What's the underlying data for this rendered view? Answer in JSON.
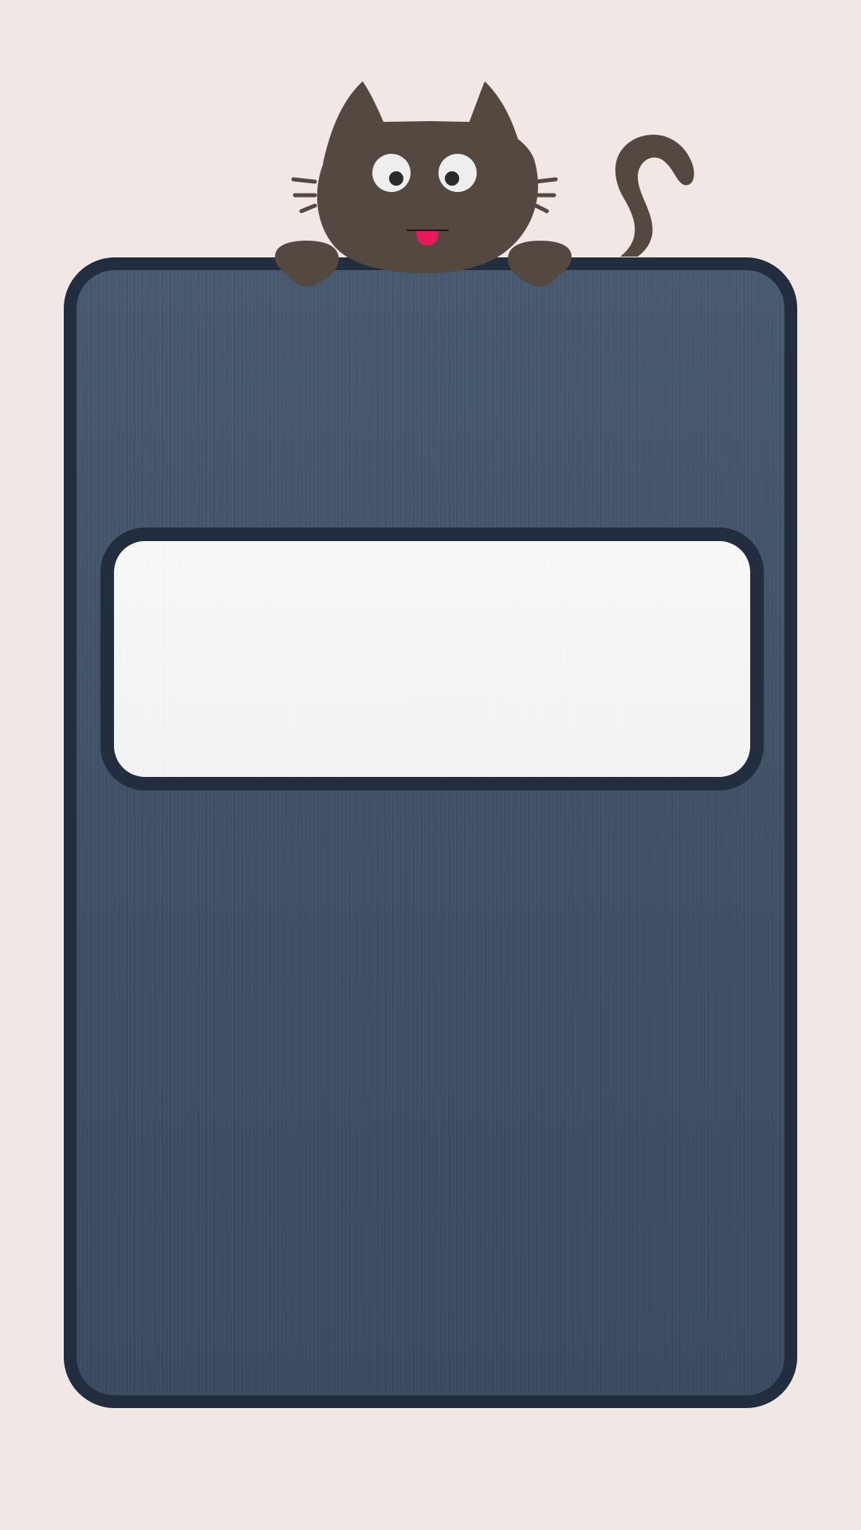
{
  "display": {
    "text": ""
  },
  "colors": {
    "background": "#f1e8e6",
    "panel": "#435369",
    "panel_border": "#222d3f",
    "display_fill": "#f5f5f5",
    "cat_fur": "#544840",
    "cat_eye_white": "#eeeeee",
    "cat_pupil": "#2b2b2b",
    "cat_tongue": "#e8195b"
  },
  "icons": {
    "mascot": "cat-peeking-icon"
  }
}
